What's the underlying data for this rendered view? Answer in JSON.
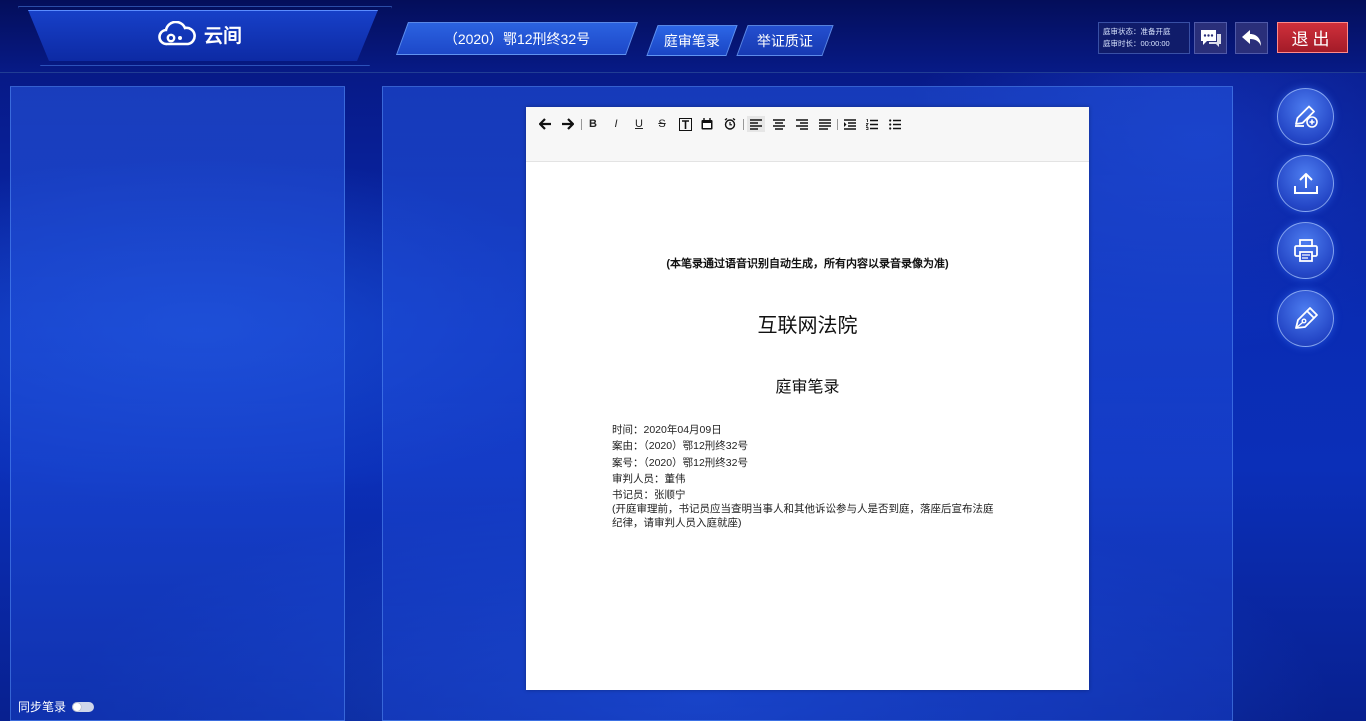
{
  "app": {
    "brand": "云间"
  },
  "tabs": {
    "case_number": "（2020）鄂12刑终32号",
    "record": "庭审笔录",
    "evidence": "举证质证"
  },
  "status": {
    "state_label": "庭审状态：准备开庭",
    "duration_label": "庭审时长：00:00:00"
  },
  "header_buttons": {
    "exit_label": "退出",
    "chat_icon": "chat-icon",
    "back_icon": "back-arrow-icon"
  },
  "sidebar": {
    "sync_label": "同步笔录",
    "sync_enabled": false
  },
  "editor": {
    "toolbar": [
      {
        "name": "undo-icon",
        "glyph": "🡐"
      },
      {
        "name": "redo-icon",
        "glyph": "🡒"
      },
      {
        "name": "bold-icon",
        "glyph": "B"
      },
      {
        "name": "italic-icon",
        "glyph": "I"
      },
      {
        "name": "underline-icon",
        "glyph": "U"
      },
      {
        "name": "strikethrough-icon",
        "glyph": "S"
      },
      {
        "name": "text-box-icon",
        "glyph": "T"
      },
      {
        "name": "calendar-icon",
        "glyph": "▦"
      },
      {
        "name": "alarm-clock-icon",
        "glyph": "⏰"
      },
      {
        "name": "align-left-icon",
        "glyph": "≡"
      },
      {
        "name": "align-center-icon",
        "glyph": "≡"
      },
      {
        "name": "align-right-icon",
        "glyph": "≡"
      },
      {
        "name": "align-justify-icon",
        "glyph": "≡"
      },
      {
        "name": "indent-icon",
        "glyph": "☰"
      },
      {
        "name": "ordered-list-icon",
        "glyph": "☰"
      },
      {
        "name": "unordered-list-icon",
        "glyph": "☰"
      }
    ],
    "document": {
      "note": "(本笔录通过语音识别自动生成，所有内容以录音录像为准)",
      "court": "互联网法院",
      "title": "庭审笔录",
      "lines": [
        "时间：2020年04月09日",
        "案由：（2020）鄂12刑终32号",
        "案号：（2020）鄂12刑终32号",
        "审判人员：董伟",
        "书记员：张顺宁"
      ],
      "instruction": "(开庭审理前，书记员应当查明当事人和其他诉讼参与人是否到庭，落座后宣布法庭纪律，请审判人员入庭就座)"
    }
  },
  "side_actions": [
    {
      "name": "edit-note-icon"
    },
    {
      "name": "upload-icon"
    },
    {
      "name": "print-icon"
    },
    {
      "name": "sign-pen-icon"
    }
  ],
  "colors": {
    "background": "#0a2cb4",
    "exit_button": "#c0282f",
    "tab": "#2c66e6"
  }
}
